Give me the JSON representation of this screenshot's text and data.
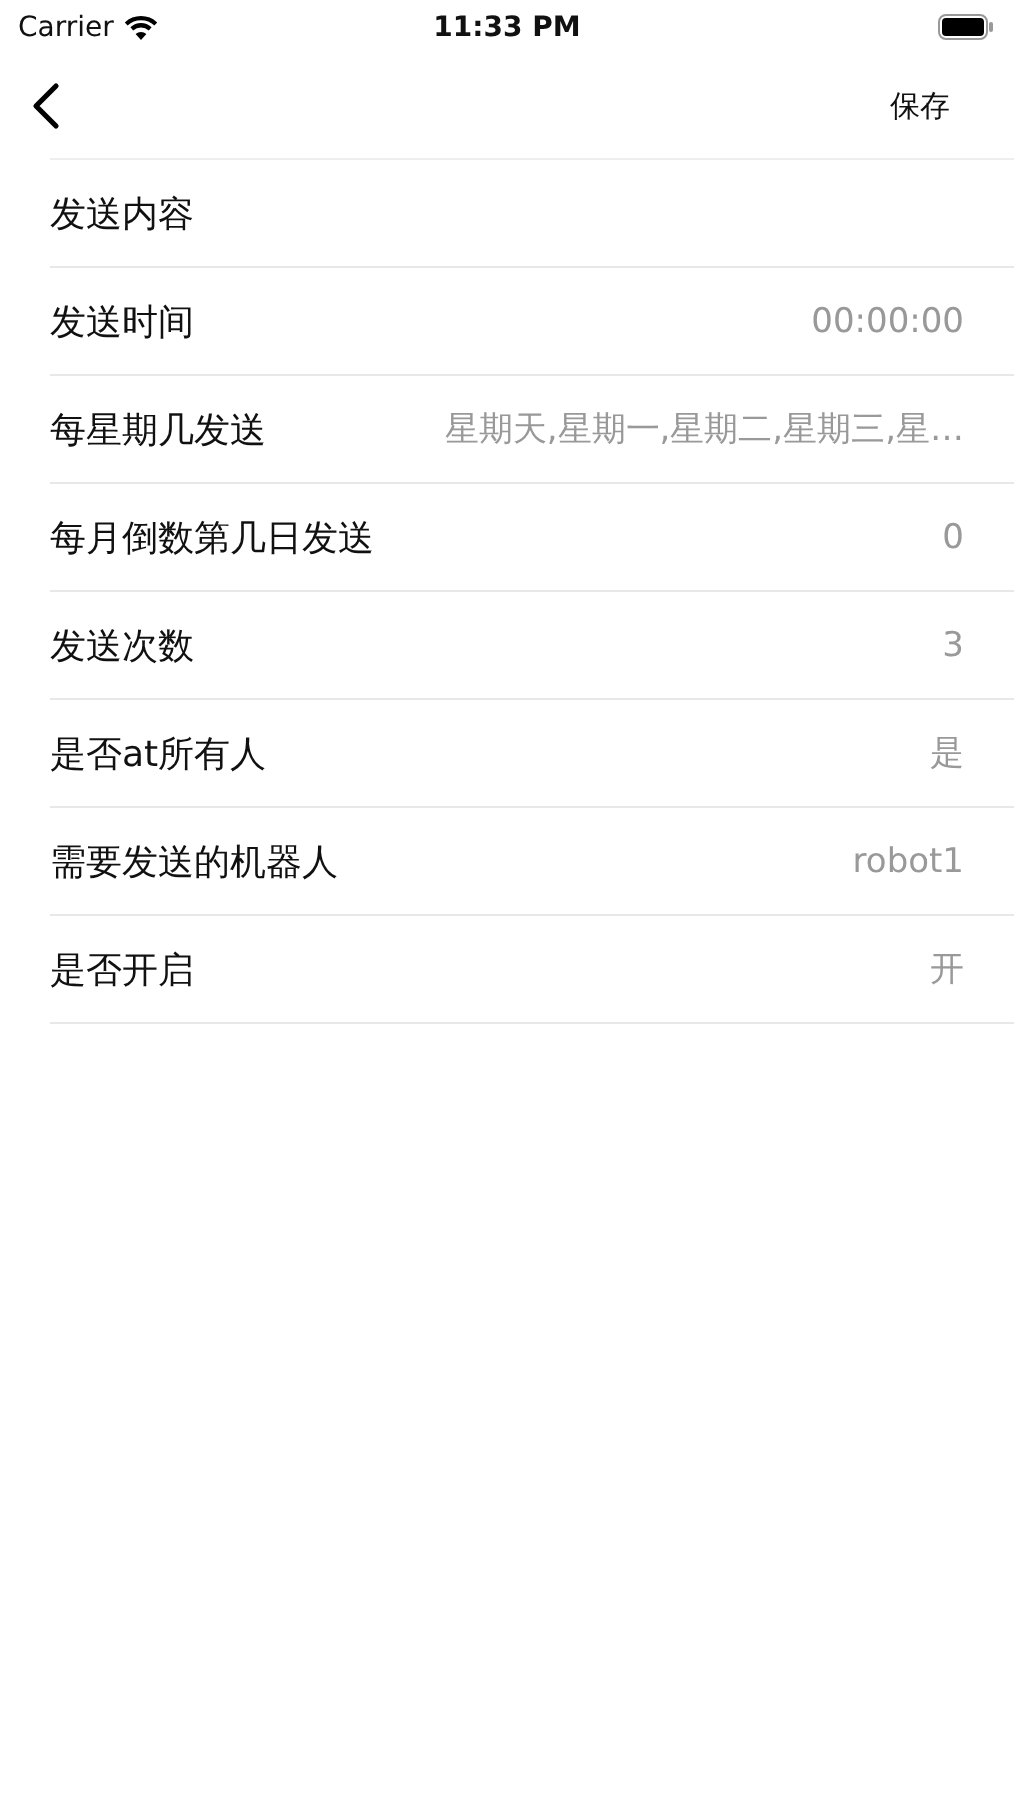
{
  "status_bar": {
    "carrier": "Carrier",
    "time": "11:33 PM"
  },
  "nav_bar": {
    "action": "保存"
  },
  "rows": [
    {
      "label": "发送内容"
    },
    {
      "label": "发送时间",
      "value": "00:00:00"
    },
    {
      "label": "每星期几发送",
      "value": "星期天,星期一,星期二,星期三,星…"
    },
    {
      "label": "每月倒数第几日发送",
      "value": "0"
    },
    {
      "label": "发送次数",
      "value": "3"
    },
    {
      "label": "是否at所有人",
      "value": "是"
    },
    {
      "label": "需要发送的机器人",
      "value": "robot1"
    },
    {
      "label": "是否开启",
      "value": "开"
    }
  ]
}
